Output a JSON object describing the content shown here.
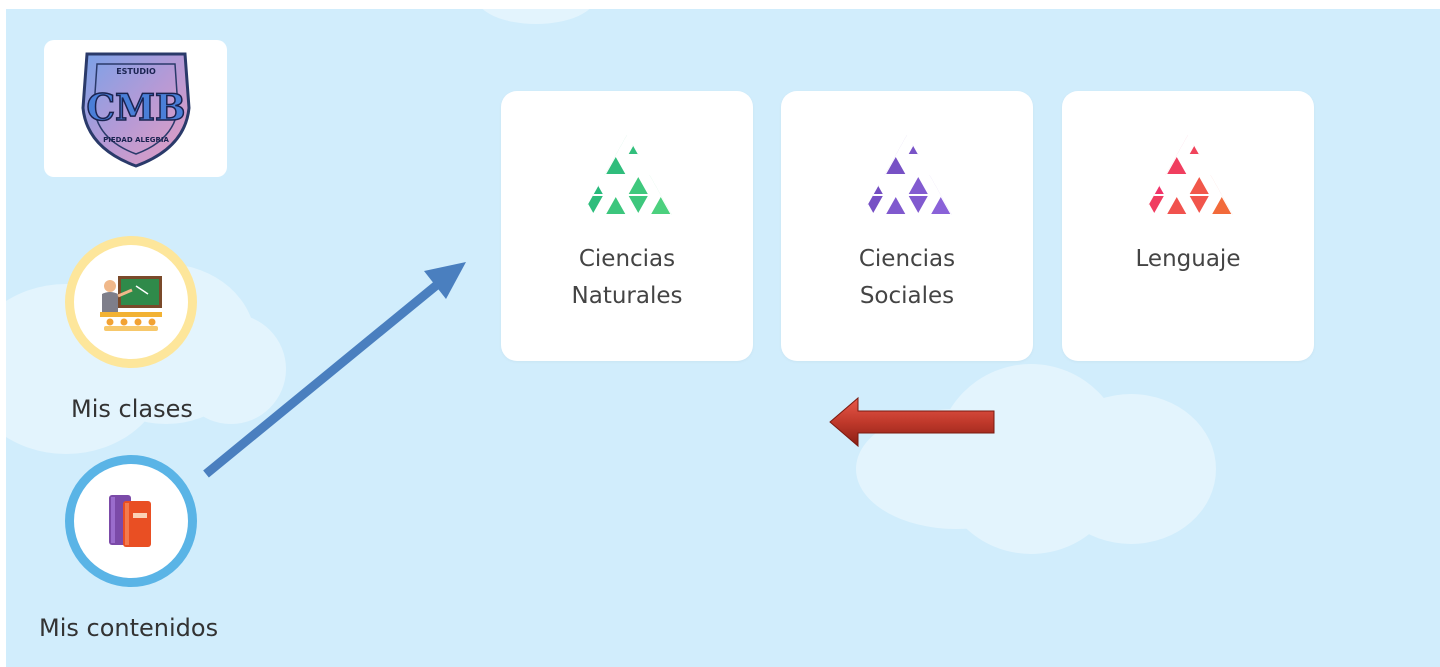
{
  "logo": {
    "top_text": "ESTUDIO",
    "monogram": "CMB",
    "bottom_text": "PIEDAD ALEGRIA"
  },
  "nav": {
    "clases": {
      "label": "Mis clases",
      "icon": "teacher-classroom-icon"
    },
    "contenidos": {
      "label": "Mis contenidos",
      "icon": "books-icon"
    }
  },
  "subjects": [
    {
      "label": "Ciencias\nNaturales",
      "icon": "triangle-mosaic-icon",
      "color_a": "#1ab07a",
      "color_b": "#4cd07e"
    },
    {
      "label": "Ciencias\nSociales",
      "icon": "triangle-mosaic-icon",
      "color_a": "#6a45b8",
      "color_b": "#8a62d8"
    },
    {
      "label": "Lenguaje",
      "icon": "triangle-mosaic-icon",
      "color_a": "#ef1f79",
      "color_b": "#f26a3a"
    }
  ],
  "colors": {
    "background": "#d1edfc",
    "clases_ring": "#fde69b",
    "contenidos_ring": "#5ab4e6",
    "blue_arrow": "#4a7fbf",
    "red_arrow": "#c0392b"
  }
}
